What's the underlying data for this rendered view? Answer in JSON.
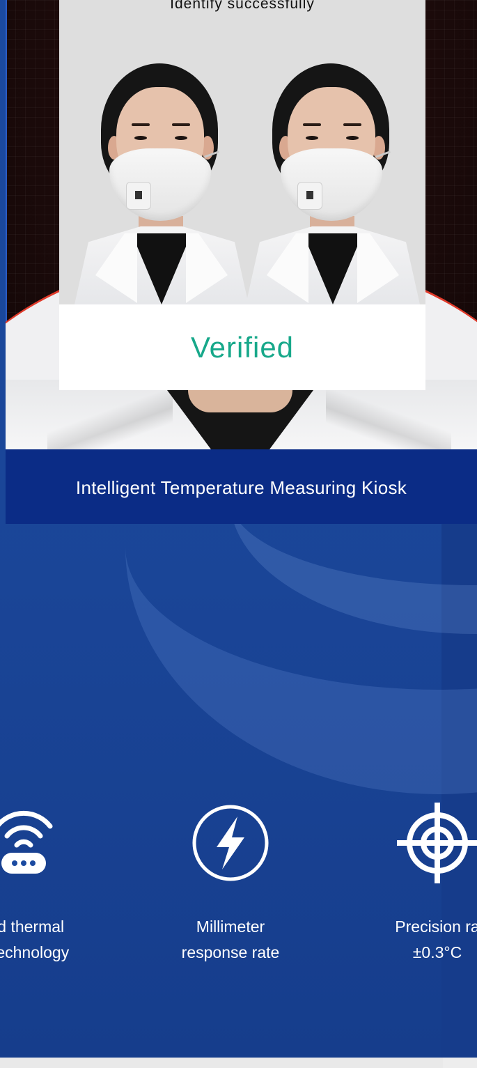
{
  "kiosk_screen": {
    "status_text": "Identify successfully",
    "verified_text": "Verified"
  },
  "banner": {
    "title": "Intelligent Temperature Measuring Kiosk"
  },
  "features": [
    {
      "icon": "wifi-router-icon",
      "line1": "red thermal",
      "line2": "g technology"
    },
    {
      "icon": "lightning-circle-icon",
      "line1": "Millimeter",
      "line2": "response rate"
    },
    {
      "icon": "crosshair-target-icon",
      "line1": "Precision ra",
      "line2": "±0.3°C"
    }
  ],
  "colors": {
    "verified": "#17a88a",
    "banner": "#0b2c86",
    "page_bg": "#1b4aa0",
    "accent_red": "#e03a2a"
  }
}
